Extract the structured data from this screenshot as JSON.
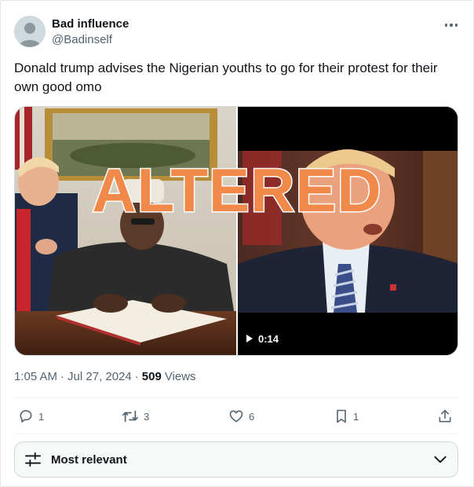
{
  "author": {
    "display_name": "Bad influence",
    "handle": "@Badinself"
  },
  "tweet": {
    "text": "Donald trump advises the Nigerian youths to go for their protest for their own good omo"
  },
  "media": {
    "overlay_text": "ALTERED",
    "video_duration": "0:14",
    "overlay_color": "#f0894a"
  },
  "meta": {
    "time": "1:05 AM",
    "separator": "·",
    "date": "Jul 27, 2024",
    "views_count": "509",
    "views_label": "Views"
  },
  "actions": {
    "replies": "1",
    "reposts": "3",
    "likes": "6",
    "bookmarks": "1"
  },
  "sort": {
    "label": "Most relevant"
  },
  "icons": [
    "more-icon",
    "reply-icon",
    "repost-icon",
    "like-icon",
    "bookmark-icon",
    "share-icon",
    "play-icon",
    "filter-icon",
    "chevron-down-icon"
  ]
}
